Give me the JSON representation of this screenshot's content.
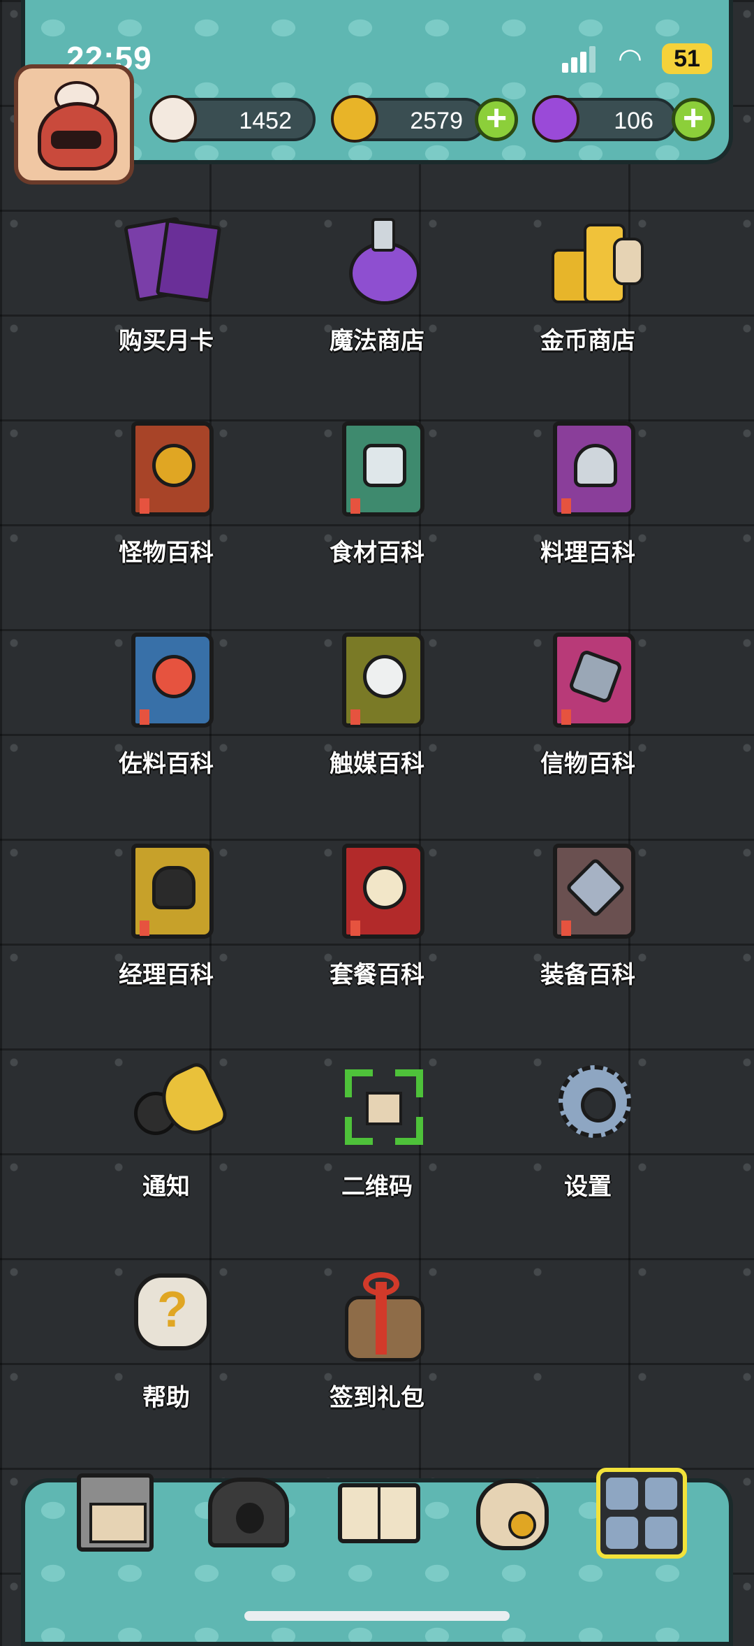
{
  "status_bar": {
    "time": "22:59",
    "battery": "51"
  },
  "currencies": {
    "eyeball": {
      "icon": "eyeball-icon",
      "value": "1452"
    },
    "coins": {
      "icon": "coin-icon",
      "value": "2579"
    },
    "potion": {
      "icon": "potion-icon",
      "value": "106"
    }
  },
  "menu": [
    {
      "label": "购买月卡",
      "icon": "monthly-card-icon"
    },
    {
      "label": "魔法商店",
      "icon": "magic-shop-icon"
    },
    {
      "label": "金币商店",
      "icon": "coin-shop-icon"
    },
    {
      "label": "怪物百科",
      "icon": "monster-book-icon"
    },
    {
      "label": "食材百科",
      "icon": "ingredient-book-icon"
    },
    {
      "label": "料理百科",
      "icon": "cuisine-book-icon"
    },
    {
      "label": "佐料百科",
      "icon": "seasoning-book-icon"
    },
    {
      "label": "触媒百科",
      "icon": "catalyst-book-icon"
    },
    {
      "label": "信物百科",
      "icon": "token-book-icon"
    },
    {
      "label": "经理百科",
      "icon": "manager-book-icon"
    },
    {
      "label": "套餐百科",
      "icon": "set-meal-book-icon"
    },
    {
      "label": "装备百科",
      "icon": "equipment-book-icon"
    },
    {
      "label": "通知",
      "icon": "megaphone-icon"
    },
    {
      "label": "二维码",
      "icon": "qr-code-icon"
    },
    {
      "label": "设置",
      "icon": "gear-icon"
    },
    {
      "label": "帮助",
      "icon": "help-icon"
    },
    {
      "label": "签到礼包",
      "icon": "gift-icon"
    }
  ],
  "bottom_nav": [
    {
      "icon": "restaurant-icon"
    },
    {
      "icon": "dungeon-icon"
    },
    {
      "icon": "open-book-icon"
    },
    {
      "icon": "money-bag-icon"
    },
    {
      "icon": "grid-menu-icon"
    }
  ],
  "colors": {
    "panel": "#5fb7b2",
    "background": "#2b2e31",
    "plus": "#8ccf3a"
  }
}
